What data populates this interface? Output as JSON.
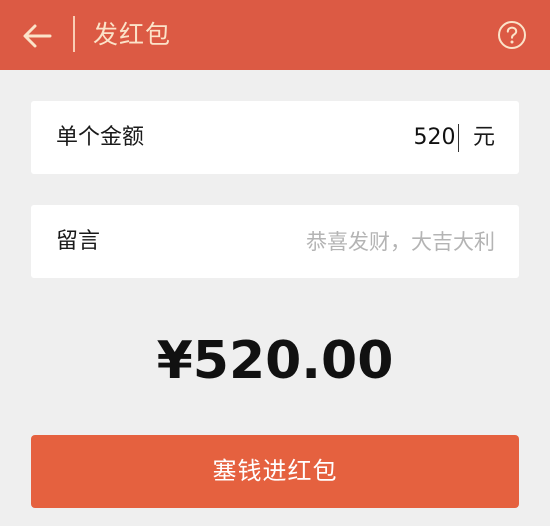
{
  "header": {
    "back_icon": "arrow-left-icon",
    "title": "发红包",
    "help_icon": "question-circle-icon"
  },
  "amount": {
    "label": "单个金额",
    "value": "520",
    "unit": "元"
  },
  "note": {
    "label": "留言",
    "placeholder": "恭喜发财，大吉大利"
  },
  "total": "¥520.00",
  "submit_label": "塞钱进红包",
  "colors": {
    "header_bg": "#dc5a44",
    "header_fg": "#fbe3c9",
    "button_bg": "#e5613f",
    "page_bg": "#efefef"
  }
}
